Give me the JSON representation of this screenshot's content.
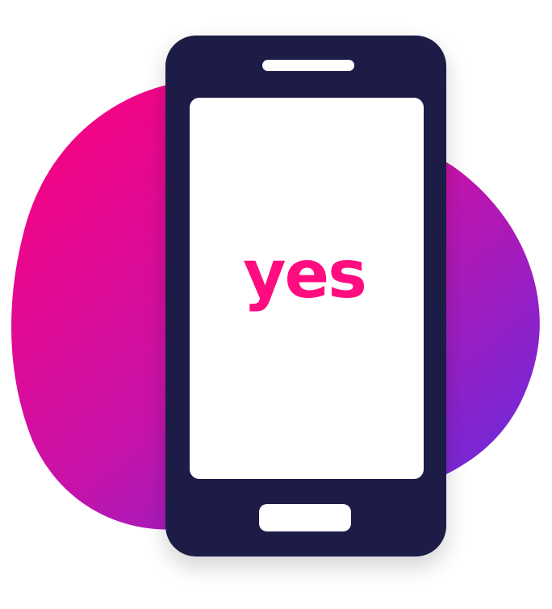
{
  "illustration": {
    "logo_text": "yes",
    "colors": {
      "blob_start": "#ff007a",
      "blob_mid": "#c812a8",
      "blob_end": "#5a2fe6",
      "phone_body": "#1c1f47",
      "screen": "#ffffff",
      "logo": "#ff0d80",
      "speaker": "#ffffff",
      "home_button": "#ffffff"
    },
    "icons": {
      "phone": "smartphone-icon",
      "background": "gradient-blob"
    }
  }
}
